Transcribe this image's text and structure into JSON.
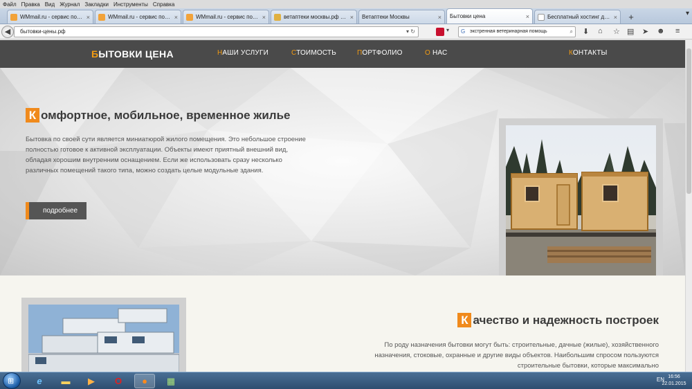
{
  "menubar": [
    "Файл",
    "Правка",
    "Вид",
    "Журнал",
    "Закладки",
    "Инструменты",
    "Справка"
  ],
  "tabs": [
    {
      "label": "WMmail.ru - сервис почт...",
      "active": false
    },
    {
      "label": "WMmail.ru - сервис почт...",
      "active": false
    },
    {
      "label": "WMmail.ru - сервис почт...",
      "active": false
    },
    {
      "label": "ветаптеки москвы.рф —...",
      "active": false
    },
    {
      "label": "Ветаптеки Москвы",
      "active": false
    },
    {
      "label": "Бытовки цена",
      "active": true
    },
    {
      "label": "Бесплатный хостинг для с...",
      "active": false
    }
  ],
  "newtab_symbol": "+",
  "tabscroll_symbol": "▾",
  "url": "бытовки-цены.рф",
  "search_value": "экстренная ветеринарная помощь",
  "site": {
    "logo_first": "Б",
    "logo_rest": "ЫТОВКИ ЦЕНА",
    "nav": [
      {
        "first": "Н",
        "rest": "АШИ УСЛУГИ"
      },
      {
        "first": "С",
        "rest": "ТОИМОСТЬ"
      },
      {
        "first": "П",
        "rest": "ОРТФОЛИО"
      },
      {
        "first": "О",
        "rest": " НАС"
      },
      {
        "first": "К",
        "rest": "ОНТАКТЫ"
      }
    ],
    "hero": {
      "heading_first": "К",
      "heading_rest": "омфортное, мобильное, временное жилье",
      "text": "Бытовка по своей сути является миниатюрой жилого помещения. Это небольшое строение полностью готовое к активной эксплуатации. Объекты имеют приятный внешний вид, обладая хорошим внутренним оснащением. Если же использовать сразу несколько различных помещений такого типа, можно создать целые модульные здания.",
      "button": "подробнее"
    },
    "section2": {
      "heading_first": "К",
      "heading_rest": "ачество и надежность построек",
      "text": "По роду назначения бытовки могут быть: строительные, дачные (жилые), хозяйственного назначения, стоковые, охранные и другие виды объектов. Наибольшим спросом пользуются строительные бытовки, которые максимально"
    }
  },
  "taskbar": {
    "tray_lang": "EN",
    "time": "16:56",
    "date": "22.01.2015"
  }
}
